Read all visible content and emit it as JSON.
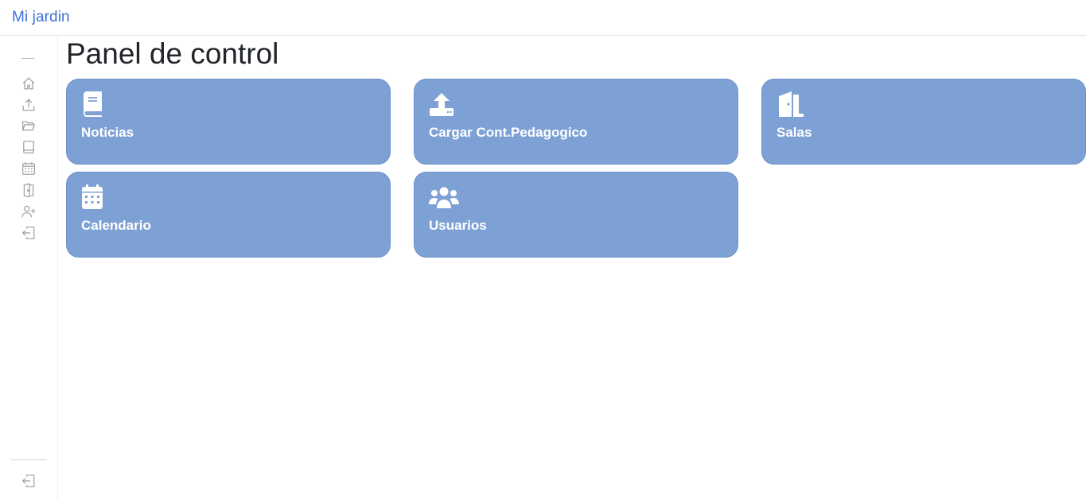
{
  "header": {
    "brand": "Mi jardin"
  },
  "sidebar": {
    "items": [
      {
        "icon": "home-icon"
      },
      {
        "icon": "upload-icon"
      },
      {
        "icon": "folder-icon"
      },
      {
        "icon": "book-icon"
      },
      {
        "icon": "calendar-icon"
      },
      {
        "icon": "door-icon"
      },
      {
        "icon": "add-user-icon"
      },
      {
        "icon": "login-icon"
      }
    ],
    "bottom_icon": "logout-icon"
  },
  "main": {
    "title": "Panel de control",
    "cards": [
      {
        "label": "Noticias",
        "icon": "book-icon"
      },
      {
        "label": "Cargar Cont.Pedagogico",
        "icon": "upload-icon"
      },
      {
        "label": "Salas",
        "icon": "door-icon"
      },
      {
        "label": "Calendario",
        "icon": "calendar-icon"
      },
      {
        "label": "Usuarios",
        "icon": "users-icon"
      }
    ]
  },
  "colors": {
    "brand": "#3b6fd8",
    "card_bg": "#7ea1d5",
    "card_text": "#ffffff",
    "sidebar_icon": "#9aa0a6"
  }
}
